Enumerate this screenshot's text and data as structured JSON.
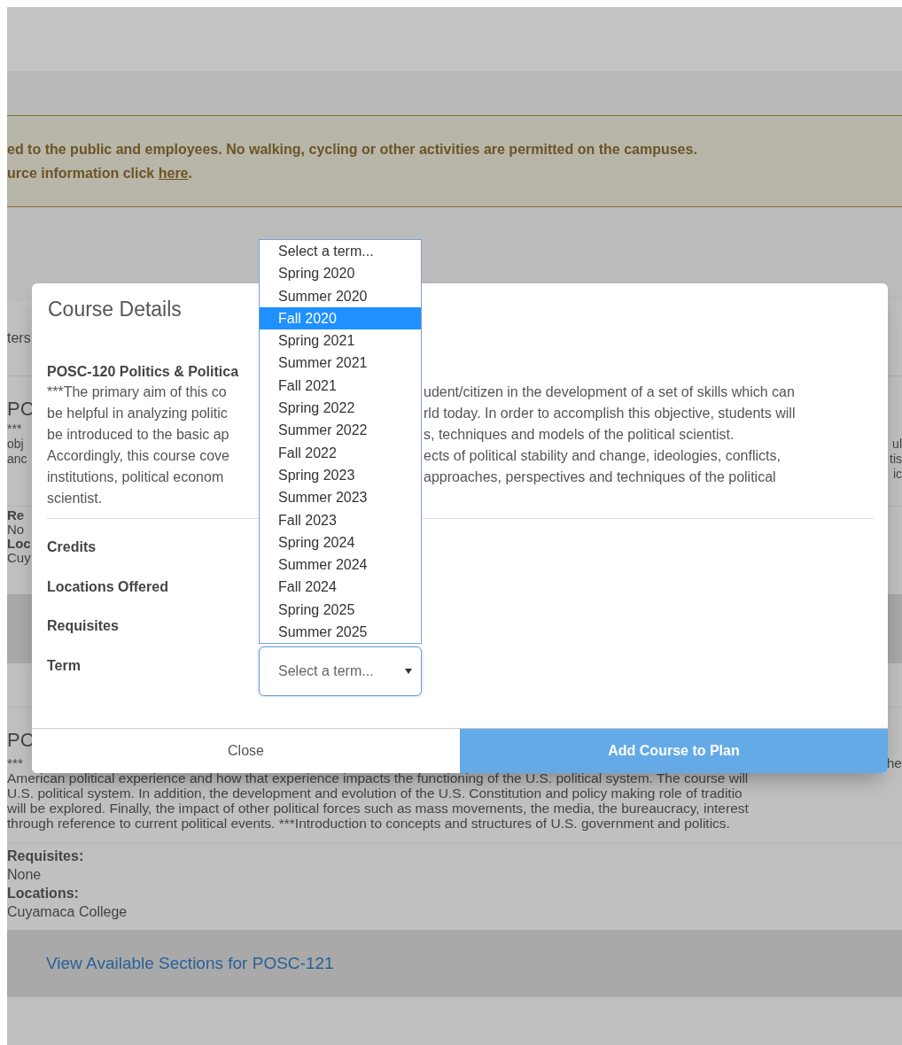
{
  "alert": {
    "line_1": "ed to the public and employees. No walking, cycling or other activities are permitted on the campuses.",
    "line_2_before": "urce information click ",
    "line_2_link": "here",
    "line_2_after": "."
  },
  "background_course_1": {
    "label_fragment": "ters",
    "title": "PC",
    "description_rows": [
      {
        "left": "***"
      },
      {
        "left": "obj",
        "right": "ul"
      },
      {
        "left": "anc",
        "right": "tis"
      },
      {
        "right": "ic"
      }
    ],
    "details": [
      {
        "text": "Re",
        "bold": true
      },
      {
        "text": "No",
        "bold": false
      },
      {
        "text": "Loc",
        "bold": true
      },
      {
        "text": "Cuy",
        "bold": false
      }
    ]
  },
  "background_course_2": {
    "title": "PC",
    "description_first_line": {
      "left": "***",
      "right": "he"
    },
    "description_lines": [
      "American political experience and how that experience impacts the functioning of the U.S. political system. The course will",
      "U.S. political system. In addition, the development and evolution of the U.S. Constitution and policy making role of traditio",
      "will be explored. Finally, the impact of other political forces such as mass movements, the media, the bureaucracy, interest",
      "through reference to current political events. ***Introduction to concepts and structures of U.S. government and politics."
    ],
    "details": [
      {
        "text": "Requisites:",
        "bold": true
      },
      {
        "text": "None",
        "bold": false
      },
      {
        "text": "Locations:",
        "bold": true
      },
      {
        "text": "Cuyamaca College",
        "bold": false
      }
    ],
    "sections_link": "View Available Sections for POSC-121"
  },
  "modal": {
    "title": "Course Details",
    "course_title": "POSC-120 Politics & Politica",
    "description_lines": [
      {
        "left": "***The primary aim of this co",
        "right": "udent/citizen in the development of a set of skills which can"
      },
      {
        "left": "be helpful in analyzing politic",
        "right": "rld today. In order to accomplish this objective, students will"
      },
      {
        "left": "be introduced to the basic ap",
        "right": "s, techniques and models of the political scientist."
      },
      {
        "left": "Accordingly, this course cove",
        "right": "ects of political stability and change, ideologies, conflicts,"
      },
      {
        "left": "institutions, political econom",
        "right": "approaches, perspectives and techniques of the political"
      },
      {
        "left": "scientist."
      }
    ],
    "fields": [
      "Credits",
      "Locations Offered",
      "Requisites",
      "Term"
    ],
    "term_select": {
      "value": "Select a term..."
    },
    "dropdown_options": [
      {
        "label": "Select a term...",
        "selected": false
      },
      {
        "label": "Spring 2020",
        "selected": false
      },
      {
        "label": "Summer 2020",
        "selected": false
      },
      {
        "label": "Fall 2020",
        "selected": true
      },
      {
        "label": "Spring 2021",
        "selected": false
      },
      {
        "label": "Summer 2021",
        "selected": false
      },
      {
        "label": "Fall 2021",
        "selected": false
      },
      {
        "label": "Spring 2022",
        "selected": false
      },
      {
        "label": "Summer 2022",
        "selected": false
      },
      {
        "label": "Fall 2022",
        "selected": false
      },
      {
        "label": "Spring 2023",
        "selected": false
      },
      {
        "label": "Summer 2023",
        "selected": false
      },
      {
        "label": "Fall 2023",
        "selected": false
      },
      {
        "label": "Spring 2024",
        "selected": false
      },
      {
        "label": "Summer 2024",
        "selected": false
      },
      {
        "label": "Fall 2024",
        "selected": false
      },
      {
        "label": "Spring 2025",
        "selected": false
      },
      {
        "label": "Summer 2025",
        "selected": false
      }
    ],
    "buttons": [
      {
        "label": "Close",
        "kind": "secondary"
      },
      {
        "label": "Add Course to Plan",
        "kind": "primary"
      }
    ]
  }
}
